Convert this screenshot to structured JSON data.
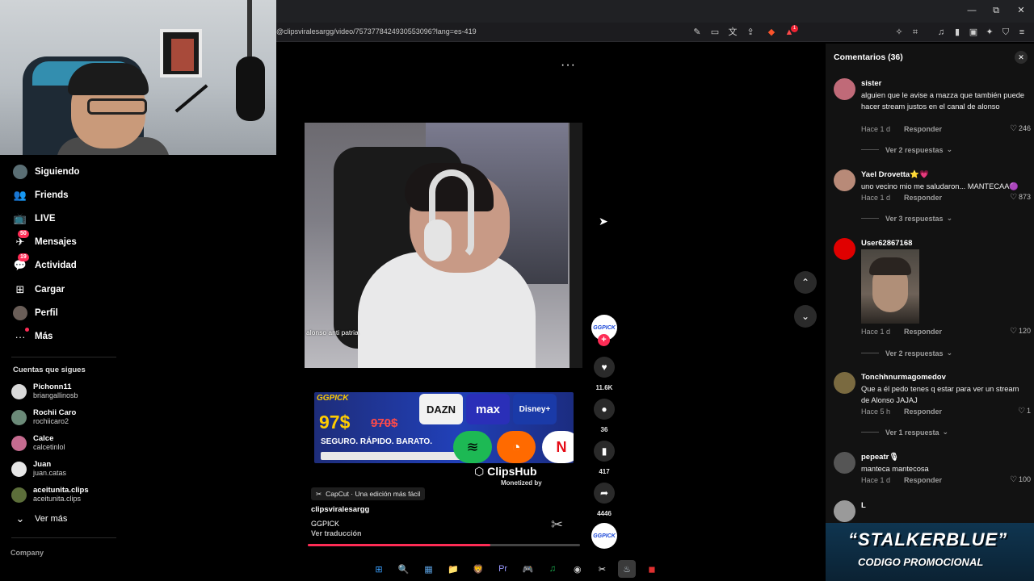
{
  "browser": {
    "url": "@clipsviralesargg/video/7573778424930553096?lang=es-419",
    "minimize": "—",
    "restore": "⧉",
    "close": "✕",
    "brave_badge": "1"
  },
  "nav": {
    "items": [
      {
        "label": "Siguiendo",
        "icon": "avatar-icon"
      },
      {
        "label": "Friends",
        "icon": "friends-icon",
        "glyph": "👥"
      },
      {
        "label": "LIVE",
        "icon": "live-tv-icon",
        "glyph": "📺"
      },
      {
        "label": "Mensajes",
        "icon": "messages-icon",
        "glyph": "✈",
        "badge": "50"
      },
      {
        "label": "Actividad",
        "icon": "activity-icon",
        "glyph": "💬",
        "badge": "19"
      },
      {
        "label": "Cargar",
        "icon": "upload-icon",
        "glyph": "⊞"
      },
      {
        "label": "Perfil",
        "icon": "profile-icon"
      },
      {
        "label": "Más",
        "icon": "more-icon",
        "glyph": "···"
      }
    ],
    "following_title": "Cuentas que sigues",
    "following": [
      {
        "name": "Pichonn11",
        "user": "briangallinosb",
        "color": "#d9d9d9"
      },
      {
        "name": "Rochii Caro",
        "user": "rochiicaro2",
        "color": "#6b8a78"
      },
      {
        "name": "Calce",
        "user": "calcetinlol",
        "color": "#c46b8f"
      },
      {
        "name": "Juan",
        "user": "juan.catas",
        "color": "#e6e6e6"
      },
      {
        "name": "aceitunita.clips",
        "user": "aceitunita.clips",
        "color": "#5c6e3a"
      }
    ],
    "see_more": "Ver más",
    "see_more_icon": "⌄",
    "company": "Company"
  },
  "video": {
    "more_dots": "···",
    "caption": "alonso anti patria",
    "ad": {
      "brand": "GGPICK",
      "price": "97$",
      "old_price": "970$",
      "slogan": "SEGURO. RÁPIDO. BARATO.",
      "logos": [
        "DAZN",
        "max",
        "Disney+"
      ]
    },
    "clipshub": "ClipsHub",
    "monetized": "Monetized by",
    "capcut": "CapCut · Una edición más fácil",
    "author": "clipsviralesargg",
    "description": "GGPICK",
    "translate": "Ver traducción",
    "progress": 0.67
  },
  "actions": {
    "avatar_text": "GGPICK",
    "likes": "11.6K",
    "comments": "36",
    "saves": "417",
    "shares": "4446"
  },
  "comments": {
    "title": "Comentarios (36)",
    "reply_label": "Responder",
    "list": [
      {
        "user": "sister",
        "text": "alguien que le avise a mazza que también puede hacer stream justos en el canal de alonso",
        "time": "Hace 1 d",
        "likes": "246",
        "more": "Ver 2 respuestas",
        "avatar": "#c06a78"
      },
      {
        "user": "Yael Drovetta⭐💗",
        "text": "uno vecino mio me saludaron... MANTECAA🟣",
        "time": "Hace 1 d",
        "likes": "873",
        "more": "Ver 3 respuestas",
        "avatar": "#b88a78"
      },
      {
        "user": "User62867168",
        "text": "",
        "time": "Hace 1 d",
        "likes": "120",
        "more": "Ver 2 respuestas",
        "avatar": "#e00000"
      },
      {
        "user": "Tonchhnurmagomedov",
        "text": "Que a él pedo tenes q estar para ver un stream de Alonso JAJAJ",
        "time": "Hace 5 h",
        "likes": "1",
        "more": "Ver 1 respuesta",
        "avatar": "#7a6a40"
      },
      {
        "user": "pepeatr🎙",
        "text": "manteca mantecosa",
        "time": "Hace 1 d",
        "likes": "100",
        "more": "",
        "avatar": "#555"
      },
      {
        "user": "L",
        "text": "",
        "time": "",
        "likes": "",
        "more": "",
        "avatar": "#9a9a9a"
      }
    ]
  },
  "overlay": {
    "line1": "“STALKERBLUE”",
    "line2": "CODIGO PROMOCIONAL"
  },
  "taskbar": [
    {
      "name": "windows-start-icon",
      "glyph": "⊞",
      "color": "#3aa0ff"
    },
    {
      "name": "search-icon",
      "glyph": "🔍",
      "color": "#ffffff"
    },
    {
      "name": "widgets-icon",
      "glyph": "▦",
      "color": "#5aa0e0"
    },
    {
      "name": "file-explorer-icon",
      "glyph": "📁",
      "color": "#f0c040"
    },
    {
      "name": "brave-browser-icon",
      "glyph": "🦁",
      "color": "#fb542b"
    },
    {
      "name": "premiere-icon",
      "glyph": "Pr",
      "color": "#9999ff"
    },
    {
      "name": "discord-icon",
      "glyph": "🎮",
      "color": "#5865f2"
    },
    {
      "name": "spotify-icon",
      "glyph": "♫",
      "color": "#1db954"
    },
    {
      "name": "obs-icon",
      "glyph": "◉",
      "color": "#cccccc"
    },
    {
      "name": "capcut-icon",
      "glyph": "✂",
      "color": "#ffffff"
    },
    {
      "name": "steam-icon",
      "glyph": "♨",
      "color": "#c7d5e0"
    },
    {
      "name": "app-red-icon",
      "glyph": "◼",
      "color": "#e03030"
    }
  ]
}
